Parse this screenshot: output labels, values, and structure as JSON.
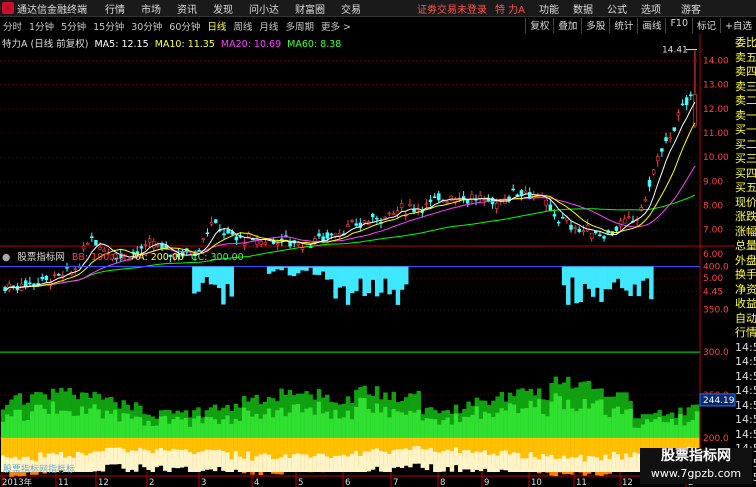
{
  "menubar": {
    "app_title": "通达信金融终端",
    "items": [
      "行情",
      "市场",
      "资讯",
      "发现",
      "问小达",
      "财富圈",
      "交易"
    ],
    "login": "证劵交易未登录",
    "stock_name": "特 力A",
    "right_items": [
      "功能",
      "数据",
      "公式",
      "选项"
    ],
    "guest": "游客"
  },
  "toolbar": {
    "periods": [
      "分时",
      "1分钟",
      "5分钟",
      "15分钟",
      "30分钟",
      "60分钟",
      "日线",
      "周线",
      "月线",
      "多周期",
      "更多 >"
    ],
    "active_period": "日线",
    "right_tools": [
      "复权",
      "叠加",
      "多股",
      "统计",
      "画线",
      "F10",
      "标记",
      "+自选"
    ]
  },
  "main_chart": {
    "title": "特力A (日线 前复权)",
    "ma5": "MA5: 12.15",
    "ma10": "MA10: 11.35",
    "ma20": "MA20: 10.69",
    "ma60": "MA60: 8.38",
    "max_label": "14.41",
    "y_ticks": [
      "14.00",
      "13.00",
      "12.00",
      "11.00",
      "10.00",
      "9.00",
      "8.00",
      "7.00",
      "6.00",
      "5.00",
      "4.45"
    ],
    "colors": {
      "ma5": "#ffffff",
      "ma10": "#ffff00",
      "ma20": "#ff40ff",
      "ma60": "#00ff00",
      "up": "#ff4040",
      "down": "#40ffff"
    }
  },
  "indicator": {
    "name": "股票指标网",
    "bb": "BB: 100.00",
    "aa": "AA: 200.00",
    "cc": "CC: 300.00",
    "y_ticks": [
      "400.0",
      "350.0",
      "300.0",
      "250.0",
      "200.0"
    ],
    "current_value": "244.19",
    "bottom_label": "股票指标网指标标"
  },
  "x_axis": {
    "labels": [
      "2013年",
      "11",
      "12",
      "2",
      "3",
      "4",
      "5",
      "6",
      "7",
      "8",
      "9",
      "10",
      "11",
      "12",
      "2"
    ]
  },
  "right_panel": {
    "items": [
      "委比",
      "卖五",
      "卖四",
      "卖三",
      "卖二",
      "卖一",
      "买一",
      "买二",
      "买三",
      "买四",
      "买五",
      "现价",
      "涨跌",
      "涨幅",
      "总量",
      "外盘",
      "换手",
      "净资",
      "收益",
      "自动",
      "行情",
      "14:5",
      "14:5",
      "14:5",
      "14:5",
      "14:5",
      "14:5",
      "14:5",
      "14:5",
      "14:5",
      "14:5"
    ]
  },
  "watermark": {
    "line1": "股票指标网",
    "line2": "www.7gpzb.com"
  }
}
